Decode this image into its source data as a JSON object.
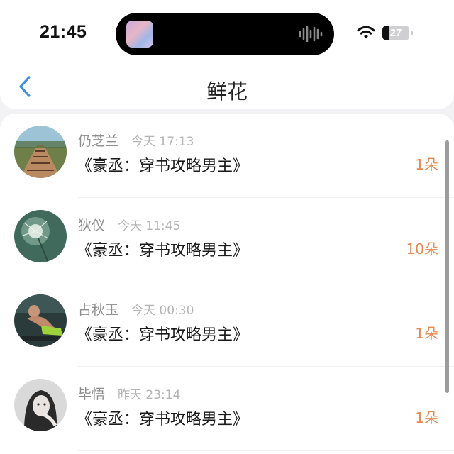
{
  "status_bar": {
    "time": "21:45",
    "battery": "27",
    "battery_level": 0.27
  },
  "header": {
    "title": "鲜花"
  },
  "list": [
    {
      "name": "仍芝兰",
      "time": "今天 17:13",
      "book": "《豪丞：穿书攻略男主》",
      "count": "1朵"
    },
    {
      "name": "狄仪",
      "time": "今天 11:45",
      "book": "《豪丞：穿书攻略男主》",
      "count": "10朵"
    },
    {
      "name": "占秋玉",
      "time": "今天 00:30",
      "book": "《豪丞：穿书攻略男主》",
      "count": "1朵"
    },
    {
      "name": "毕悟",
      "time": "昨天 23:14",
      "book": "《豪丞：穿书攻略男主》",
      "count": "1朵"
    }
  ],
  "icons": {
    "back": "chevron-left-icon",
    "wifi": "wifi-icon",
    "audio": "audio-wave-icon"
  },
  "colors": {
    "accent_blue": "#3d8fe0",
    "count_orange": "#e8894f"
  }
}
